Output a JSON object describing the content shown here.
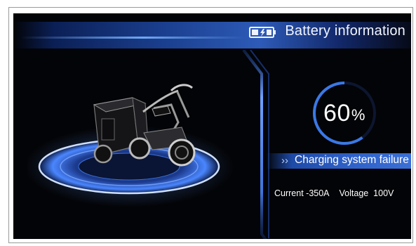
{
  "header": {
    "title": "Battery information",
    "icon": "battery-icon"
  },
  "battery": {
    "percent": 60,
    "percent_value": "60",
    "percent_unit": "%"
  },
  "alert": {
    "chevron": "››",
    "text": "Charging system failure"
  },
  "readout": {
    "current": "Current -350A",
    "voltage": "Voltage  100V"
  },
  "colors": {
    "accent": "#2f62c9",
    "ring": "#3a78e6",
    "background": "#030407"
  },
  "images": {
    "vehicle": "electric-cargo-tricycle"
  }
}
